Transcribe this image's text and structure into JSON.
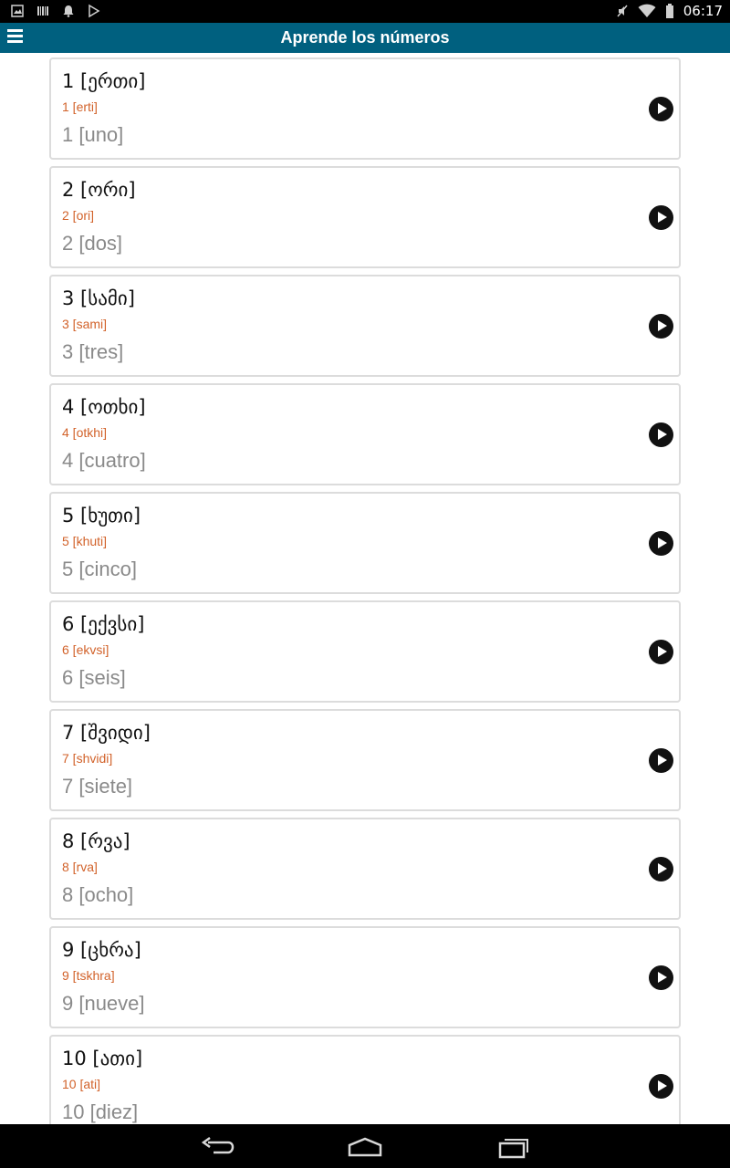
{
  "status_bar": {
    "time": "06:17",
    "left_icons": [
      "image-icon",
      "barcode-icon",
      "notification-bell-icon",
      "play-store-icon"
    ],
    "right_icons": [
      "mute-icon",
      "wifi-icon",
      "battery-icon"
    ]
  },
  "app_bar": {
    "title": "Aprende los números",
    "menu_icon": "hamburger-menu-icon"
  },
  "items": [
    {
      "native": "1 [ერთი]",
      "translit": "1 [erti]",
      "meaning": "1 [uno]"
    },
    {
      "native": "2 [ორი]",
      "translit": "2 [ori]",
      "meaning": "2 [dos]"
    },
    {
      "native": "3 [სამი]",
      "translit": "3 [sami]",
      "meaning": "3 [tres]"
    },
    {
      "native": "4 [ოთხი]",
      "translit": "4 [otkhi]",
      "meaning": "4 [cuatro]"
    },
    {
      "native": "5 [ხუთი]",
      "translit": "5 [khuti]",
      "meaning": "5 [cinco]"
    },
    {
      "native": "6 [ექვსი]",
      "translit": "6 [ekvsi]",
      "meaning": "6 [seis]"
    },
    {
      "native": "7 [შვიდი]",
      "translit": "7 [shvidi]",
      "meaning": "7 [siete]"
    },
    {
      "native": "8 [რვა]",
      "translit": "8 [rva]",
      "meaning": "8 [ocho]"
    },
    {
      "native": "9 [ცხრა]",
      "translit": "9 [tskhra]",
      "meaning": "9 [nueve]"
    },
    {
      "native": "10 [ათი]",
      "translit": "10 [ati]",
      "meaning": "10 [diez]"
    }
  ],
  "nav_bar": {
    "buttons": [
      "back-icon",
      "home-icon",
      "recent-apps-icon"
    ]
  },
  "colors": {
    "app_bar": "#00607f",
    "transliteration": "#d2622a",
    "meaning": "#8a8a8a"
  }
}
